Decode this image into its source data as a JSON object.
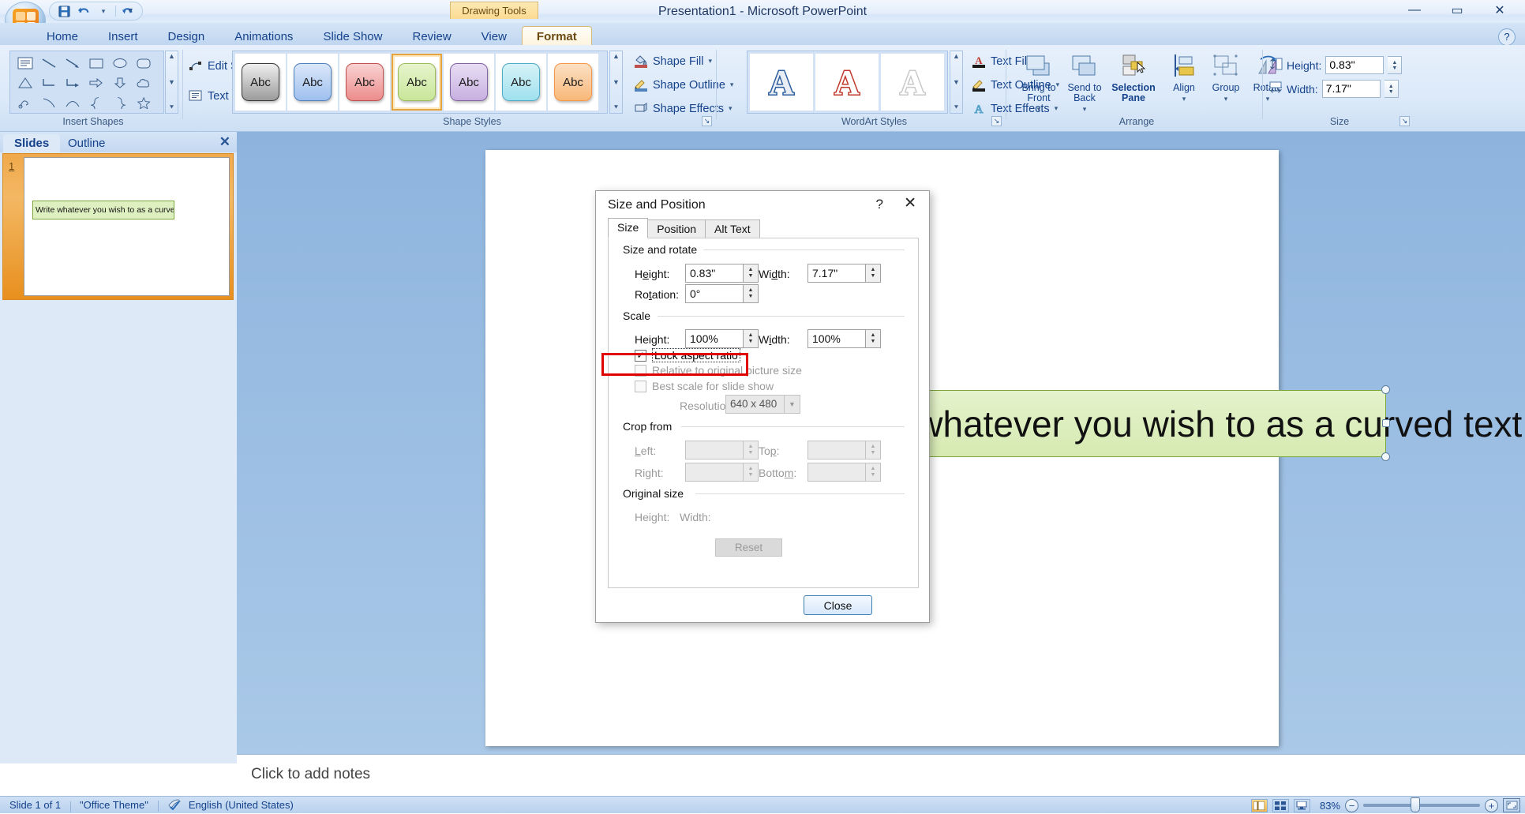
{
  "titlebar": {
    "document_title": "Presentation1 - Microsoft PowerPoint",
    "contextual_label": "Drawing Tools",
    "qat": [
      {
        "name": "save-icon",
        "glyph": "💾"
      },
      {
        "name": "undo-icon",
        "glyph": "↶"
      },
      {
        "name": "undo-dropdown-icon",
        "glyph": "▾"
      },
      {
        "name": "redo-icon",
        "glyph": "↻"
      }
    ],
    "qat_more_glyph": "≡",
    "window_controls": {
      "minimize": "─",
      "maximize": "□",
      "close": "✕"
    }
  },
  "tabs": [
    {
      "label": "Home",
      "active": false
    },
    {
      "label": "Insert",
      "active": false
    },
    {
      "label": "Design",
      "active": false
    },
    {
      "label": "Animations",
      "active": false
    },
    {
      "label": "Slide Show",
      "active": false
    },
    {
      "label": "Review",
      "active": false
    },
    {
      "label": "View",
      "active": false
    },
    {
      "label": "Format",
      "active": true,
      "contextual": true
    }
  ],
  "help_glyph": "?",
  "ribbon": {
    "groups": [
      {
        "name": "insert-shapes",
        "label": "Insert Shapes"
      },
      {
        "name": "shape-styles",
        "label": "Shape Styles"
      },
      {
        "name": "wordart-styles",
        "label": "WordArt Styles"
      },
      {
        "name": "arrange",
        "label": "Arrange"
      },
      {
        "name": "size",
        "label": "Size"
      }
    ],
    "insert_shapes": {
      "buttons": [
        {
          "label": "Edit Shape",
          "icon": "edit-shape-icon",
          "has_caret": true
        },
        {
          "label": "Text Box",
          "icon": "text-box-icon",
          "has_caret": false
        }
      ]
    },
    "shape_styles": {
      "gallery": [
        {
          "name": "style-dark",
          "fill_top": "#efefef",
          "fill_bottom": "#9b9b9b",
          "border": "#3a3a3a"
        },
        {
          "name": "style-blue",
          "fill_top": "#dbe7f9",
          "fill_bottom": "#9ec0ef",
          "border": "#4f81bd"
        },
        {
          "name": "style-red",
          "fill_top": "#f9d2d2",
          "fill_bottom": "#ec8c8c",
          "border": "#c0504d"
        },
        {
          "name": "style-green",
          "fill_top": "#e6f4cc",
          "fill_bottom": "#c9e69a",
          "border": "#9bbb59",
          "selected": true
        },
        {
          "name": "style-purple",
          "fill_top": "#e8ddf4",
          "fill_bottom": "#c7b0e0",
          "border": "#8064a2"
        },
        {
          "name": "style-teal",
          "fill_top": "#d6f3f8",
          "fill_bottom": "#9fe0ee",
          "border": "#4bacc6"
        },
        {
          "name": "style-orange",
          "fill_top": "#fce0c4",
          "fill_bottom": "#f8b878",
          "border": "#f79646"
        }
      ],
      "sample_text": "Abc",
      "buttons": [
        {
          "label": "Shape Fill",
          "icon": "shape-fill-icon",
          "has_caret": true
        },
        {
          "label": "Shape Outline",
          "icon": "shape-outline-icon",
          "has_caret": true
        },
        {
          "label": "Shape Effects",
          "icon": "shape-effects-icon",
          "has_caret": true
        }
      ]
    },
    "wordart_styles": {
      "gallery": [
        {
          "name": "wordart-blue",
          "glyph": "A",
          "color": "#2d5f9e"
        },
        {
          "name": "wordart-red",
          "glyph": "A",
          "color": "#c0392b"
        },
        {
          "name": "wordart-gray",
          "glyph": "A",
          "color": "#b3b3b3"
        }
      ],
      "buttons": [
        {
          "label": "Text Fill",
          "icon": "text-fill-icon",
          "has_caret": true
        },
        {
          "label": "Text Outline",
          "icon": "text-outline-icon",
          "has_caret": true
        },
        {
          "label": "Text Effects",
          "icon": "text-effects-icon",
          "has_caret": true
        }
      ]
    },
    "arrange": {
      "buttons": [
        {
          "label1": "Bring to",
          "label2": "Front",
          "icon": "bring-to-front-icon",
          "caret": true
        },
        {
          "label1": "Send to",
          "label2": "Back",
          "icon": "send-to-back-icon",
          "caret": true
        },
        {
          "label1": "Selection",
          "label2": "Pane",
          "icon": "selection-pane-icon",
          "caret": false
        },
        {
          "label1": "Align",
          "label2": "",
          "icon": "align-icon",
          "caret": true
        },
        {
          "label1": "Group",
          "label2": "",
          "icon": "group-icon",
          "caret": true
        },
        {
          "label1": "Rotate",
          "label2": "",
          "icon": "rotate-icon",
          "caret": true
        }
      ]
    },
    "size": {
      "height_label": "Height:",
      "height_value": "0.83\"",
      "width_label": "Width:",
      "width_value": "7.17\""
    }
  },
  "left_pane": {
    "tabs": [
      {
        "label": "Slides",
        "active": true
      },
      {
        "label": "Outline",
        "active": false
      }
    ],
    "close_glyph": "✕",
    "slides": [
      {
        "number": "1",
        "text": "Write whatever you wish to as a curved text"
      }
    ]
  },
  "slide_canvas": {
    "shape_text": "Write whatever you wish to as a curved text",
    "visible_fragment_left": "W",
    "visible_fragment_right": "as a curved text",
    "fill_color": "#dff0c0",
    "border_color": "#79a73e"
  },
  "notes": {
    "placeholder": "Click to add notes"
  },
  "statusbar": {
    "slide_indicator": "Slide 1 of 1",
    "theme": "\"Office Theme\"",
    "spellcheck_icon": "spellcheck-icon",
    "language": "English (United States)",
    "zoom_percent": "83%",
    "zoom_out_glyph": "−",
    "zoom_in_glyph": "+",
    "views": [
      {
        "name": "normal-view-button",
        "active": true
      },
      {
        "name": "slide-sorter-view-button",
        "active": false
      },
      {
        "name": "slide-show-view-button",
        "active": false
      }
    ],
    "fit_to_window_icon": "fit-slide-to-window-icon"
  },
  "dialog": {
    "title": "Size and Position",
    "help_glyph": "?",
    "close_glyph": "✕",
    "tabs": [
      {
        "label": "Size",
        "active": true
      },
      {
        "label": "Position",
        "active": false
      },
      {
        "label": "Alt Text",
        "active": false
      }
    ],
    "size_and_rotate": {
      "group_label": "Size and rotate",
      "height_label": "Height:",
      "height_value": "0.83\"",
      "width_label": "Width:",
      "width_value": "7.17\"",
      "rotation_label": "Rotation:",
      "rotation_value": "0°"
    },
    "scale": {
      "group_label": "Scale",
      "height_label": "Height:",
      "height_value": "100%",
      "width_label": "Width:",
      "width_value": "100%",
      "lock_aspect_ratio_label": "Lock aspect ratio",
      "lock_aspect_ratio_checked": true,
      "relative_label": "Relative to original picture size",
      "relative_checked": false,
      "best_scale_label": "Best scale for slide show",
      "best_scale_checked": false,
      "resolution_label": "Resolution",
      "resolution_value": "640 x 480"
    },
    "crop_from": {
      "group_label": "Crop from",
      "left_label": "Left:",
      "left_value": "",
      "top_label": "Top:",
      "top_value": "",
      "right_label": "Right:",
      "right_value": "",
      "bottom_label": "Bottom:",
      "bottom_value": ""
    },
    "original_size": {
      "group_label": "Original size",
      "height_label": "Height:",
      "width_label": "Width:",
      "reset_label": "Reset"
    },
    "close_button_label": "Close"
  },
  "annotation": {
    "highlight_color": "#e00000",
    "target": "lock-aspect-ratio-checkbox"
  }
}
